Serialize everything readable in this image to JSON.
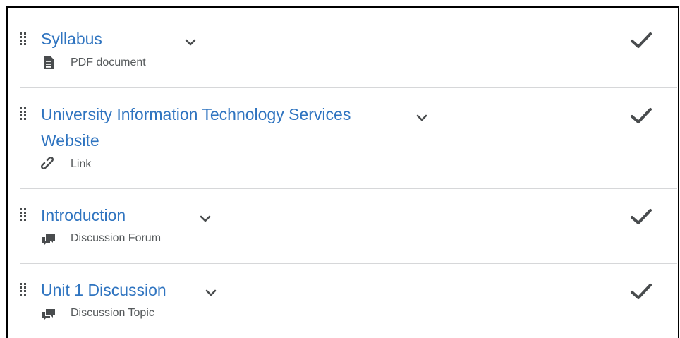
{
  "items": [
    {
      "title": "Syllabus",
      "type_label": "PDF document",
      "type_icon": "pdf-document-icon",
      "completed": true
    },
    {
      "title_line1": "University Information Technology Services",
      "title_line2": "Website",
      "type_label": "Link",
      "type_icon": "link-icon",
      "completed": true
    },
    {
      "title": "Introduction",
      "type_label": "Discussion Forum",
      "type_icon": "discussion-icon",
      "completed": true
    },
    {
      "title": "Unit 1 Discussion",
      "type_label": "Discussion Topic",
      "type_icon": "discussion-icon",
      "completed": true
    }
  ],
  "colors": {
    "link_blue": "#2f74c0",
    "meta_gray": "#565a5c",
    "icon_dark": "#494c4e",
    "divider": "#d6d7d9"
  }
}
